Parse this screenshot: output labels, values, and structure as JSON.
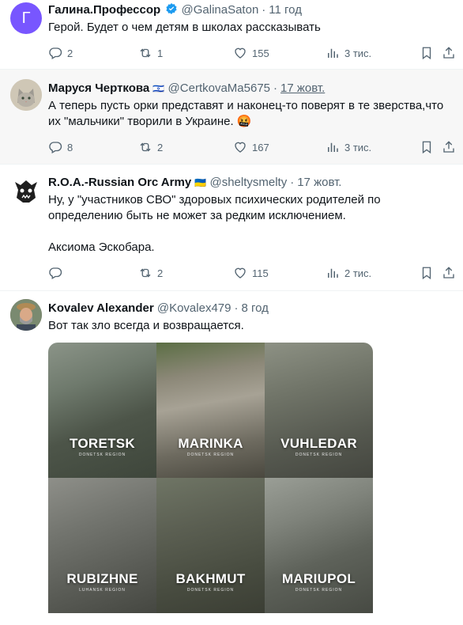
{
  "tweets": [
    {
      "name": "Галина.Профессор",
      "handle": "@GalinaSaton",
      "time": "11 год",
      "avatar_letter": "Г",
      "avatar_color": "#7856ff",
      "text": "Герой. Будет о чем детям в школах рассказывать",
      "replies": "2",
      "reposts": "1",
      "likes": "155",
      "views": "3 тис."
    },
    {
      "name": "Маруся Черткова",
      "flag": "🇮🇱",
      "handle": "@CertkovaMa5675",
      "time": "17 жовт.",
      "text": "А теперь пусть орки представят и наконец-то поверят в те зверства,что их \"мальчики\" творили в Украине. 🤬",
      "replies": "8",
      "reposts": "2",
      "likes": "167",
      "views": "3 тис."
    },
    {
      "name": "R.O.A.-Russian Orc Army",
      "flag": "🇺🇦",
      "handle": "@sheltysmelty",
      "time": "17 жовт.",
      "text_line1": "Ну, у \"участников СВО\" здоровых психических родителей по определению быть не может за редким исключением.",
      "text_line2": "Аксиома Эскобара.",
      "replies": "",
      "reposts": "2",
      "likes": "115",
      "views": "2 тис."
    },
    {
      "name": "Kovalev Alexander",
      "handle": "@Kovalex479",
      "time": "8 год",
      "text": "Вот так зло всегда и возвращается.",
      "media": [
        {
          "city": "TORETSK",
          "sub": "DONETSK REGION"
        },
        {
          "city": "MARINKA",
          "sub": "DONETSK REGION"
        },
        {
          "city": "VUHLEDAR",
          "sub": "DONETSK REGION"
        },
        {
          "city": "RUBIZHNE",
          "sub": "LUHANSK REGION"
        },
        {
          "city": "BAKHMUT",
          "sub": "DONETSK REGION"
        },
        {
          "city": "MARIUPOL",
          "sub": "DONETSK REGION"
        }
      ]
    }
  ],
  "colors": {
    "verified": "#1d9bf0",
    "secondary": "#536471",
    "reply_bg": "#f7f7f7"
  }
}
